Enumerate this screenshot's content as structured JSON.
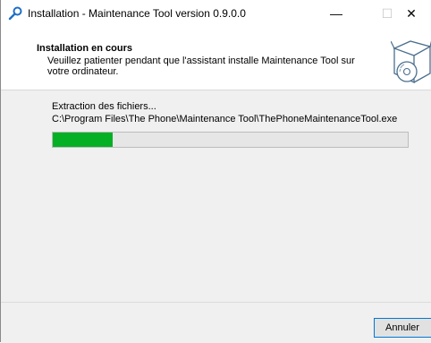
{
  "window": {
    "title": "Installation - Maintenance Tool version 0.9.0.0",
    "minimize_glyph": "—",
    "maximize_glyph": "☐",
    "close_glyph": "✕"
  },
  "header": {
    "title": "Installation en cours",
    "description": "Veuillez patienter pendant que l'assistant installe Maintenance Tool sur votre ordinateur."
  },
  "content": {
    "status": "Extraction des fichiers...",
    "path": "C:\\Program Files\\The Phone\\Maintenance Tool\\ThePhoneMaintenanceTool.exe",
    "progress_fraction": 0.17
  },
  "footer": {
    "cancel_label": "Annuler"
  },
  "colors": {
    "progress_fill": "#06b025",
    "accent_border": "#0078d7",
    "icon_blue": "#1e6fc7"
  },
  "icons": {
    "app": "installer-wrench-icon",
    "header_art": "package-cd-icon"
  }
}
